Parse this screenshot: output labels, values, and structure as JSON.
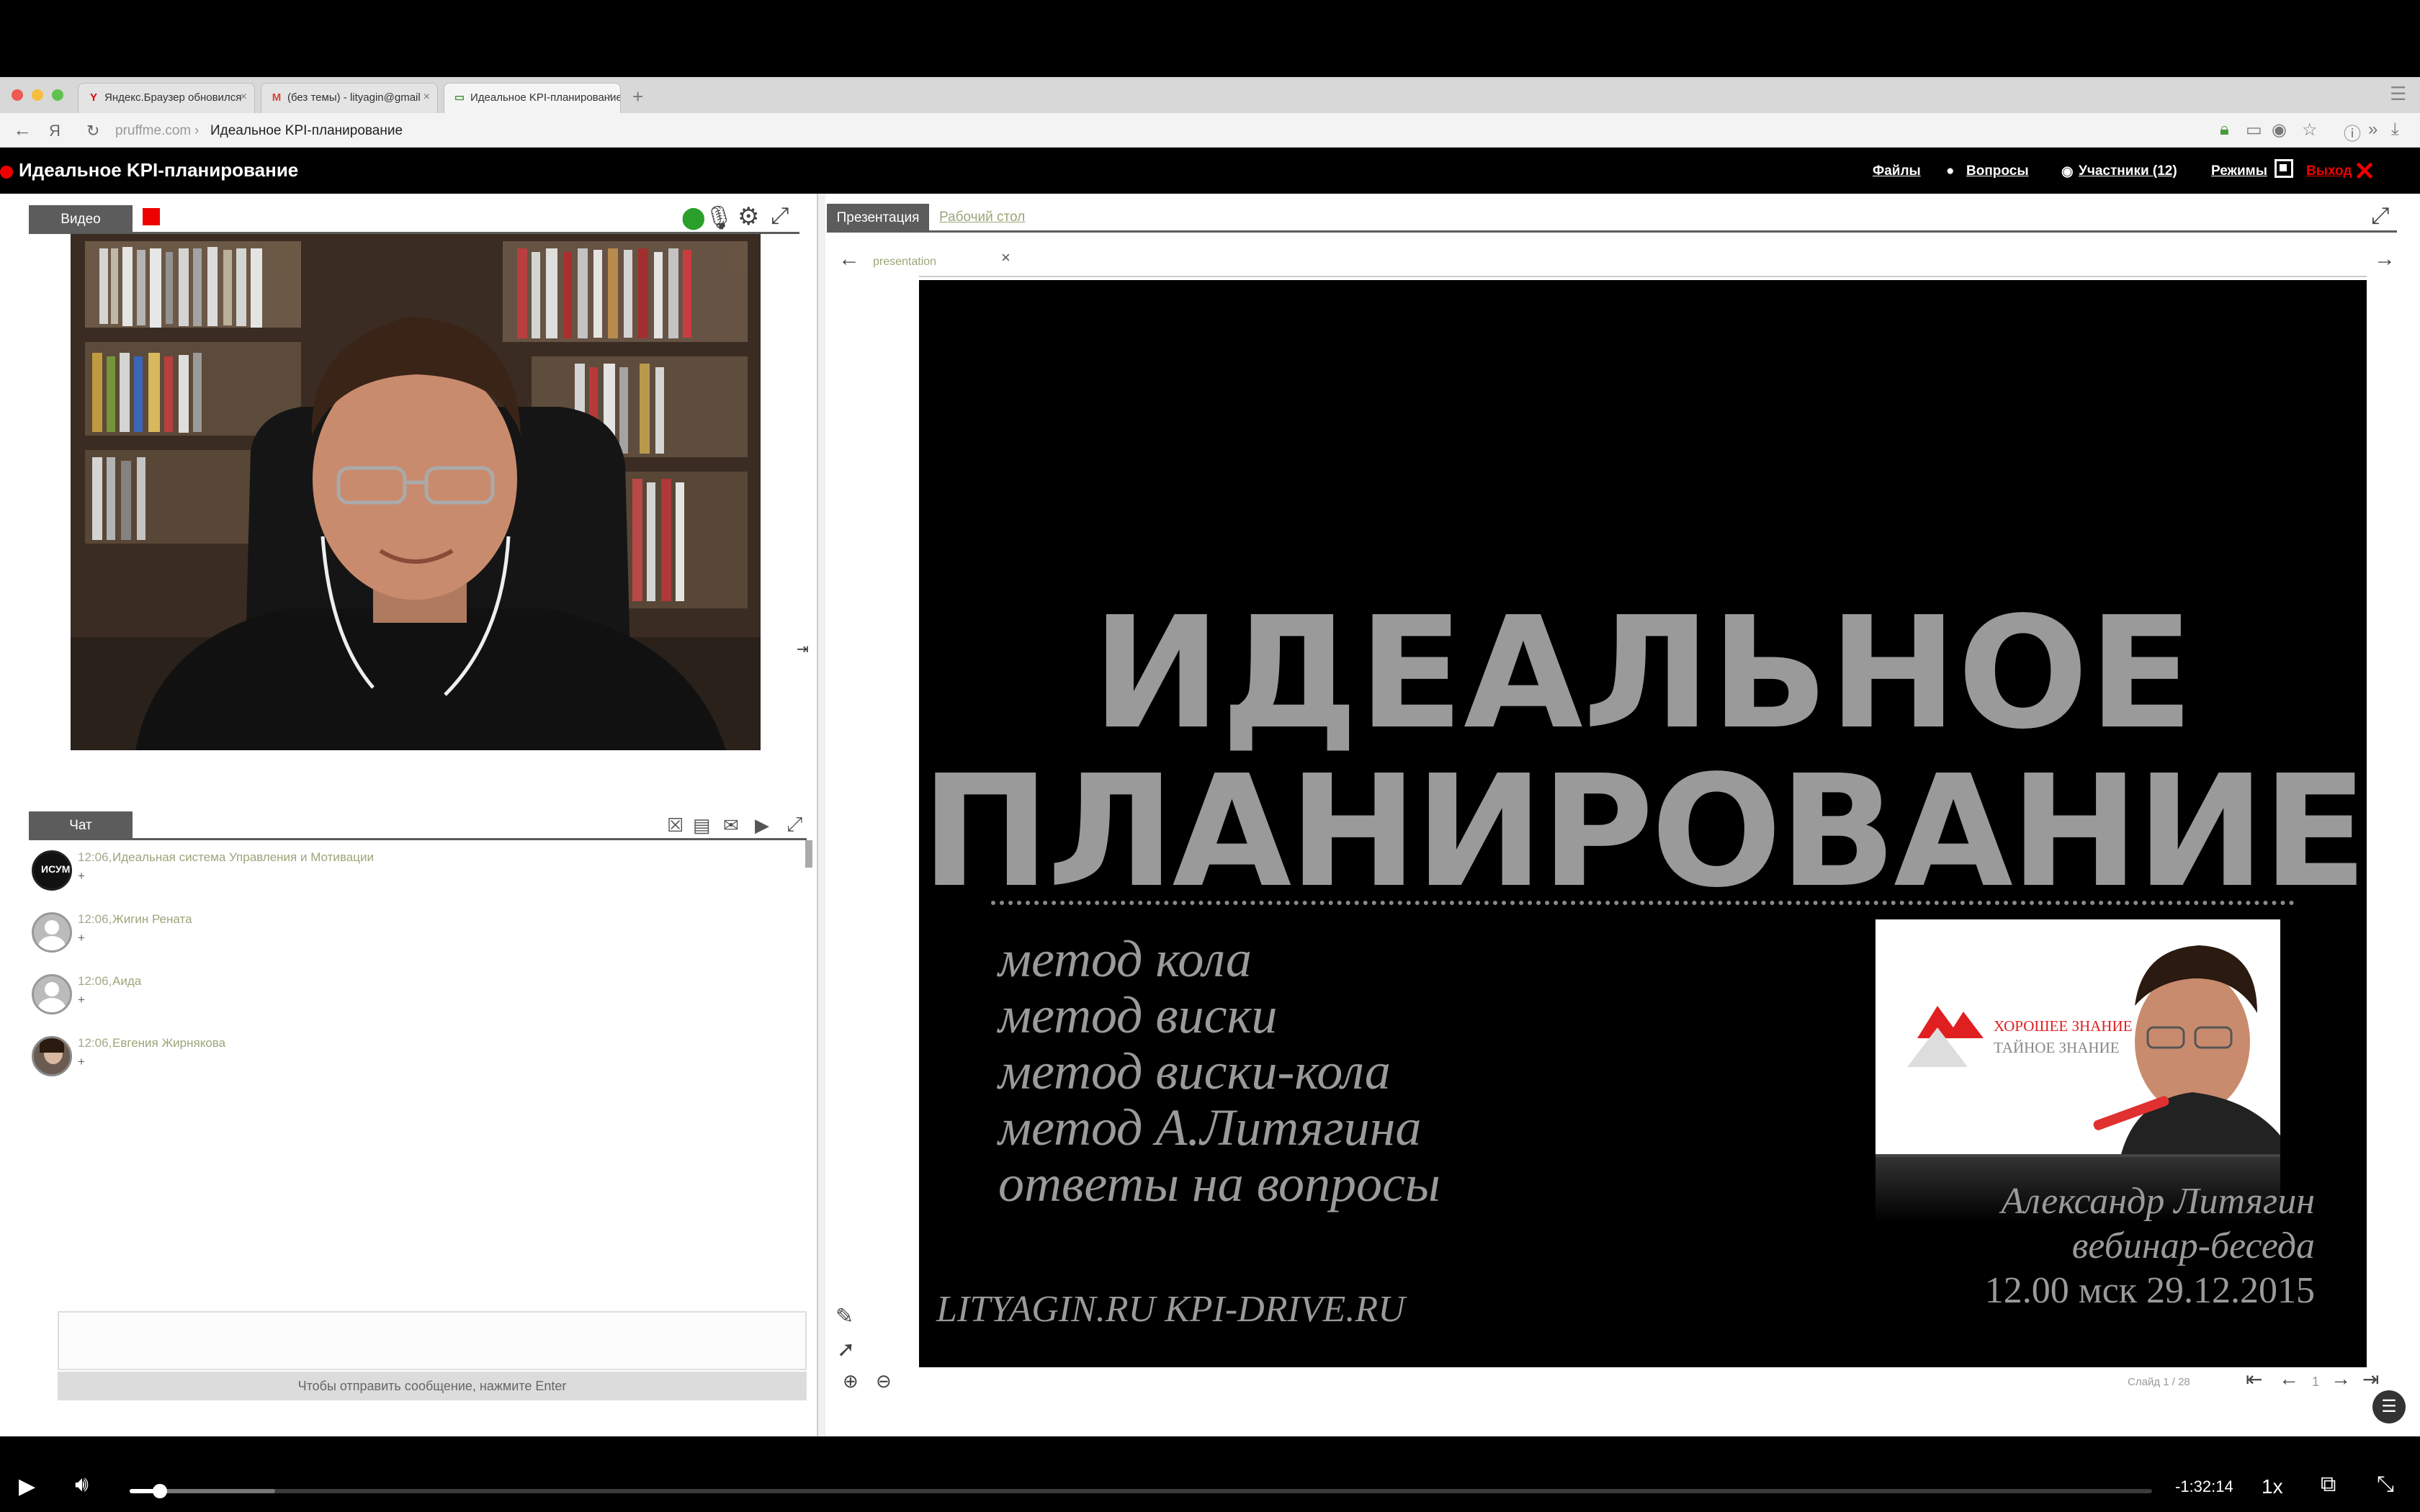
{
  "browser": {
    "tabs": [
      {
        "label": "Яндекс.Браузер обновился",
        "icon": "Y",
        "icon_color": "#e00000",
        "active": false
      },
      {
        "label": "(без темы) - lityagin@gmail",
        "icon": "M",
        "icon_color": "#d44638",
        "active": false
      },
      {
        "label": "Идеальное KPI-планирование",
        "icon": "▭",
        "icon_color": "#4a9a3c",
        "active": true
      }
    ],
    "url_domain": "pruffme.com",
    "url_separator": "›",
    "url_title": "Идеальное KPI-планирование"
  },
  "app": {
    "title": "Идеальное KPI-планирование",
    "nav": {
      "files": "Файлы",
      "questions": "Вопросы",
      "participants": "Участники (12)",
      "modes": "Режимы",
      "exit": "Выход"
    }
  },
  "video_panel": {
    "tab_label": "Видео"
  },
  "chat_panel": {
    "tab_label": "Чат",
    "messages": [
      {
        "time": "12:06,",
        "author": "Идеальная система Управления и Мотивации",
        "text": "+",
        "avatar": "logo"
      },
      {
        "time": "12:06,",
        "author": "Жигин Рената",
        "text": "+",
        "avatar": "default"
      },
      {
        "time": "12:06,",
        "author": "Аида",
        "text": "+",
        "avatar": "default"
      },
      {
        "time": "12:06,",
        "author": "Евгения Жирнякова",
        "text": "+",
        "avatar": "photo"
      }
    ],
    "input_hint": "Чтобы отправить сообщение, нажмите Enter"
  },
  "presentation_panel": {
    "tab_presentation": "Презентация",
    "tab_desktop": "Рабочий стол",
    "file_name": "presentation",
    "slide": {
      "title_line1": "ИДЕАЛЬНОЕ",
      "title_line2": "ПЛАНИРОВАНИЕ",
      "items": [
        "метод кола",
        "метод виски",
        "метод виски-кола",
        "метод А.Литягина",
        "ответы на вопросы"
      ],
      "websites": "LITYAGIN.RU  KPI-DRIVE.RU",
      "photo_brand_line1": "ХОРОШЕЕ ЗНАНИЕ",
      "photo_brand_line2": "ТАЙНОЕ ЗНАНИЕ",
      "author": "Александр Литягин",
      "format": "вебинар-беседа",
      "datetime": "12.00 мск 29.12.2015"
    },
    "slides_label": "Слайд 1 / 28",
    "current_page": "1"
  },
  "player": {
    "time_remaining": "-1:32:14",
    "speed": "1x",
    "progress_played": 0.015,
    "progress_loaded": 0.072
  }
}
